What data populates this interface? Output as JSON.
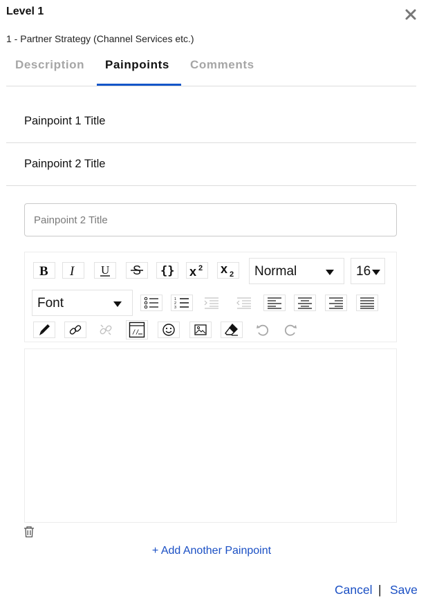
{
  "dialog": {
    "title": "Level 1",
    "subtitle": "1 - Partner Strategy (Channel Services etc.)",
    "close_icon": "close-icon"
  },
  "tabs": [
    {
      "label": "Description",
      "active": false
    },
    {
      "label": "Painpoints",
      "active": true
    },
    {
      "label": "Comments",
      "active": false
    }
  ],
  "accent_color": "#1456c9",
  "painpoints": [
    {
      "title": "Painpoint 1 Title"
    },
    {
      "title": "Painpoint 2 Title"
    }
  ],
  "editor": {
    "title_input": {
      "placeholder": "Painpoint 2 Title",
      "value": ""
    },
    "toolbar": {
      "row1": [
        "bold-icon",
        "italic-icon",
        "underline-icon",
        "strikethrough-icon",
        "code-block-icon",
        "superscript-icon",
        "subscript-icon"
      ],
      "paragraph_style": "Normal",
      "font_size": "16",
      "font_family": "Font",
      "row2": [
        "bulleted-list-icon",
        "numbered-list-icon",
        "indent-icon",
        "outdent-icon",
        "align-left-icon",
        "align-center-icon",
        "align-right-icon",
        "justify-icon"
      ],
      "row3": [
        "text-color-icon",
        "link-icon",
        "unlink-icon",
        "embed-code-icon",
        "emoji-icon",
        "image-icon",
        "clear-format-icon",
        "undo-icon",
        "redo-icon"
      ]
    },
    "body": ""
  },
  "actions": {
    "delete_icon": "trash-icon",
    "add_another": "+ Add Another Painpoint",
    "cancel": "Cancel",
    "separator": "|",
    "save": "Save"
  }
}
